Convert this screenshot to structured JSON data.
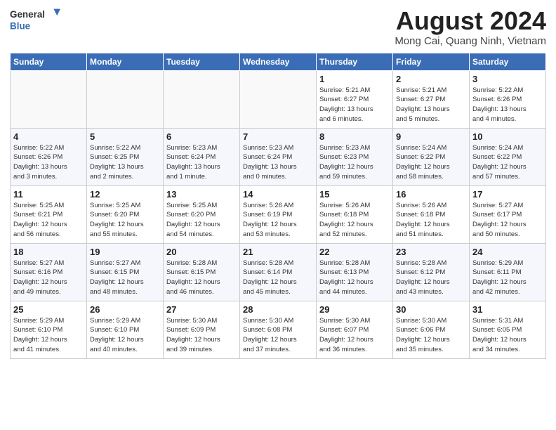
{
  "logo": {
    "general": "General",
    "blue": "Blue"
  },
  "title": "August 2024",
  "subtitle": "Mong Cai, Quang Ninh, Vietnam",
  "weekdays": [
    "Sunday",
    "Monday",
    "Tuesday",
    "Wednesday",
    "Thursday",
    "Friday",
    "Saturday"
  ],
  "weeks": [
    [
      {
        "day": "",
        "info": ""
      },
      {
        "day": "",
        "info": ""
      },
      {
        "day": "",
        "info": ""
      },
      {
        "day": "",
        "info": ""
      },
      {
        "day": "1",
        "info": "Sunrise: 5:21 AM\nSunset: 6:27 PM\nDaylight: 13 hours\nand 6 minutes."
      },
      {
        "day": "2",
        "info": "Sunrise: 5:21 AM\nSunset: 6:27 PM\nDaylight: 13 hours\nand 5 minutes."
      },
      {
        "day": "3",
        "info": "Sunrise: 5:22 AM\nSunset: 6:26 PM\nDaylight: 13 hours\nand 4 minutes."
      }
    ],
    [
      {
        "day": "4",
        "info": "Sunrise: 5:22 AM\nSunset: 6:26 PM\nDaylight: 13 hours\nand 3 minutes."
      },
      {
        "day": "5",
        "info": "Sunrise: 5:22 AM\nSunset: 6:25 PM\nDaylight: 13 hours\nand 2 minutes."
      },
      {
        "day": "6",
        "info": "Sunrise: 5:23 AM\nSunset: 6:24 PM\nDaylight: 13 hours\nand 1 minute."
      },
      {
        "day": "7",
        "info": "Sunrise: 5:23 AM\nSunset: 6:24 PM\nDaylight: 13 hours\nand 0 minutes."
      },
      {
        "day": "8",
        "info": "Sunrise: 5:23 AM\nSunset: 6:23 PM\nDaylight: 12 hours\nand 59 minutes."
      },
      {
        "day": "9",
        "info": "Sunrise: 5:24 AM\nSunset: 6:22 PM\nDaylight: 12 hours\nand 58 minutes."
      },
      {
        "day": "10",
        "info": "Sunrise: 5:24 AM\nSunset: 6:22 PM\nDaylight: 12 hours\nand 57 minutes."
      }
    ],
    [
      {
        "day": "11",
        "info": "Sunrise: 5:25 AM\nSunset: 6:21 PM\nDaylight: 12 hours\nand 56 minutes."
      },
      {
        "day": "12",
        "info": "Sunrise: 5:25 AM\nSunset: 6:20 PM\nDaylight: 12 hours\nand 55 minutes."
      },
      {
        "day": "13",
        "info": "Sunrise: 5:25 AM\nSunset: 6:20 PM\nDaylight: 12 hours\nand 54 minutes."
      },
      {
        "day": "14",
        "info": "Sunrise: 5:26 AM\nSunset: 6:19 PM\nDaylight: 12 hours\nand 53 minutes."
      },
      {
        "day": "15",
        "info": "Sunrise: 5:26 AM\nSunset: 6:18 PM\nDaylight: 12 hours\nand 52 minutes."
      },
      {
        "day": "16",
        "info": "Sunrise: 5:26 AM\nSunset: 6:18 PM\nDaylight: 12 hours\nand 51 minutes."
      },
      {
        "day": "17",
        "info": "Sunrise: 5:27 AM\nSunset: 6:17 PM\nDaylight: 12 hours\nand 50 minutes."
      }
    ],
    [
      {
        "day": "18",
        "info": "Sunrise: 5:27 AM\nSunset: 6:16 PM\nDaylight: 12 hours\nand 49 minutes."
      },
      {
        "day": "19",
        "info": "Sunrise: 5:27 AM\nSunset: 6:15 PM\nDaylight: 12 hours\nand 48 minutes."
      },
      {
        "day": "20",
        "info": "Sunrise: 5:28 AM\nSunset: 6:15 PM\nDaylight: 12 hours\nand 46 minutes."
      },
      {
        "day": "21",
        "info": "Sunrise: 5:28 AM\nSunset: 6:14 PM\nDaylight: 12 hours\nand 45 minutes."
      },
      {
        "day": "22",
        "info": "Sunrise: 5:28 AM\nSunset: 6:13 PM\nDaylight: 12 hours\nand 44 minutes."
      },
      {
        "day": "23",
        "info": "Sunrise: 5:28 AM\nSunset: 6:12 PM\nDaylight: 12 hours\nand 43 minutes."
      },
      {
        "day": "24",
        "info": "Sunrise: 5:29 AM\nSunset: 6:11 PM\nDaylight: 12 hours\nand 42 minutes."
      }
    ],
    [
      {
        "day": "25",
        "info": "Sunrise: 5:29 AM\nSunset: 6:10 PM\nDaylight: 12 hours\nand 41 minutes."
      },
      {
        "day": "26",
        "info": "Sunrise: 5:29 AM\nSunset: 6:10 PM\nDaylight: 12 hours\nand 40 minutes."
      },
      {
        "day": "27",
        "info": "Sunrise: 5:30 AM\nSunset: 6:09 PM\nDaylight: 12 hours\nand 39 minutes."
      },
      {
        "day": "28",
        "info": "Sunrise: 5:30 AM\nSunset: 6:08 PM\nDaylight: 12 hours\nand 37 minutes."
      },
      {
        "day": "29",
        "info": "Sunrise: 5:30 AM\nSunset: 6:07 PM\nDaylight: 12 hours\nand 36 minutes."
      },
      {
        "day": "30",
        "info": "Sunrise: 5:30 AM\nSunset: 6:06 PM\nDaylight: 12 hours\nand 35 minutes."
      },
      {
        "day": "31",
        "info": "Sunrise: 5:31 AM\nSunset: 6:05 PM\nDaylight: 12 hours\nand 34 minutes."
      }
    ]
  ]
}
